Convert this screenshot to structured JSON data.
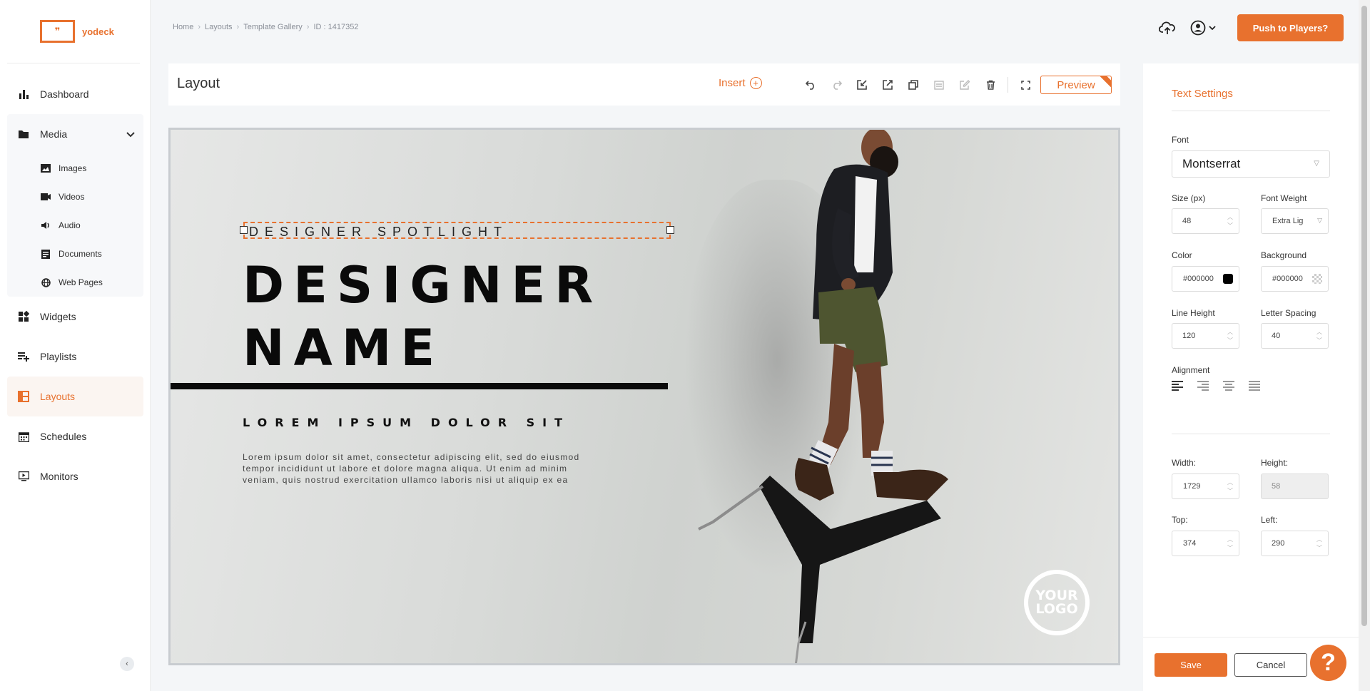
{
  "app": {
    "brand": "yodeck",
    "logo_glyph": "❞"
  },
  "sidebar": {
    "items": [
      {
        "label": "Dashboard",
        "icon": "bar-chart-icon"
      },
      {
        "label": "Media",
        "icon": "folder-icon"
      },
      {
        "label": "Widgets",
        "icon": "widgets-icon"
      },
      {
        "label": "Playlists",
        "icon": "playlist-add-icon"
      },
      {
        "label": "Layouts",
        "icon": "layout-icon",
        "active": true
      },
      {
        "label": "Schedules",
        "icon": "calendar-icon"
      },
      {
        "label": "Monitors",
        "icon": "monitor-icon"
      }
    ],
    "media_sub": [
      {
        "label": "Images",
        "icon": "image-icon"
      },
      {
        "label": "Videos",
        "icon": "video-icon"
      },
      {
        "label": "Audio",
        "icon": "audio-icon"
      },
      {
        "label": "Documents",
        "icon": "document-icon"
      },
      {
        "label": "Web Pages",
        "icon": "globe-icon"
      }
    ]
  },
  "breadcrumb": {
    "home": "Home",
    "layouts": "Layouts",
    "gallery": "Template Gallery",
    "id": "ID : 1417352"
  },
  "header": {
    "push_label": "Push to Players?"
  },
  "editor": {
    "title": "Layout",
    "insert_label": "Insert",
    "preview_label": "Preview"
  },
  "canvas": {
    "kicker": "DESIGNER SPOTLIGHT",
    "headline_line1": "DESIGNER",
    "headline_line2": "NAME",
    "subhead": "LOREM IPSUM DOLOR SIT",
    "body_line1": "Lorem ipsum dolor sit amet, consectetur adipiscing elit, sed do eiusmod",
    "body_line2": "tempor incididunt ut labore et dolore magna aliqua. Ut enim ad minim",
    "body_line3": "veniam, quis nostrud exercitation ullamco laboris nisi ut aliquip ex ea",
    "logo_line1": "YOUR",
    "logo_line2": "LOGO"
  },
  "text_settings": {
    "title": "Text Settings",
    "font_label": "Font",
    "font_value": "Montserrat",
    "size_label": "Size (px)",
    "size_value": "48",
    "weight_label": "Font Weight",
    "weight_value": "Extra Lig",
    "color_label": "Color",
    "color_value": "#000000",
    "background_label": "Background",
    "background_value": "#000000",
    "line_height_label": "Line Height",
    "line_height_value": "120",
    "letter_spacing_label": "Letter Spacing",
    "letter_spacing_value": "40",
    "alignment_label": "Alignment",
    "alignment_selected": "left",
    "width_label": "Width:",
    "width_value": "1729",
    "height_label": "Height:",
    "height_value": "58",
    "top_label": "Top:",
    "top_value": "374",
    "left_label": "Left:",
    "left_value": "290"
  },
  "footer": {
    "save_label": "Save",
    "cancel_label": "Cancel",
    "help_label": "?"
  },
  "colors": {
    "accent": "#e8712e",
    "text": "#333333",
    "canvas_text": "#0a0a0a"
  }
}
